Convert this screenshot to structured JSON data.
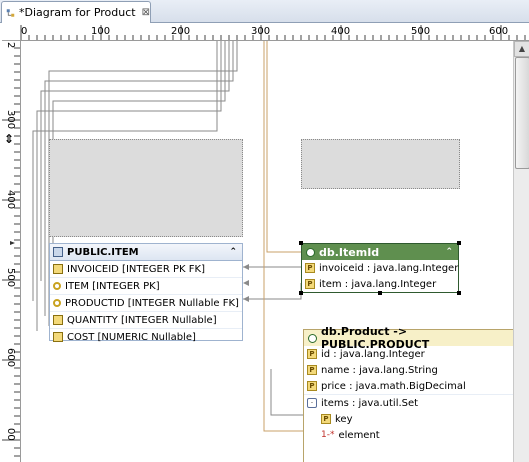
{
  "editor": {
    "tab_title": "*Diagram for Product",
    "close_glyph": "⊠"
  },
  "hruler": {
    "labels": [
      "0",
      "100",
      "200",
      "300",
      "400",
      "500",
      "600"
    ]
  },
  "vruler": {
    "labels": [
      "2",
      "300",
      "400",
      "500",
      "600",
      "00"
    ]
  },
  "public_item": {
    "title": "PUBLIC.ITEM",
    "rows": [
      "INVOICEID [INTEGER PK FK]",
      "ITEM [INTEGER PK]",
      "PRODUCTID [INTEGER Nullable FK]",
      "QUANTITY [INTEGER Nullable]",
      "COST [NUMERIC Nullable]"
    ]
  },
  "itemid": {
    "title": "db.ItemId",
    "props": [
      "invoiceid : java.lang.Integer",
      "item : java.lang.Integer"
    ]
  },
  "product": {
    "title": "db.Product -> PUBLIC.PRODUCT",
    "props": [
      "id : java.lang.Integer",
      "name : java.lang.String",
      "price : java.math.BigDecimal"
    ],
    "collection": "items : java.util.Set",
    "key": "key",
    "element": "element"
  },
  "icons": {
    "tab": "diagram-icon",
    "table": "table-icon",
    "class": "class-icon",
    "property": "property-icon",
    "collection": "collection-icon"
  },
  "colors": {
    "itemid_header": "#5f8f4f",
    "product_header": "#f7f0c8",
    "table_header": "#dde6f2",
    "association_line": "#c9a06a",
    "mapping_line": "#8a8a8a"
  }
}
